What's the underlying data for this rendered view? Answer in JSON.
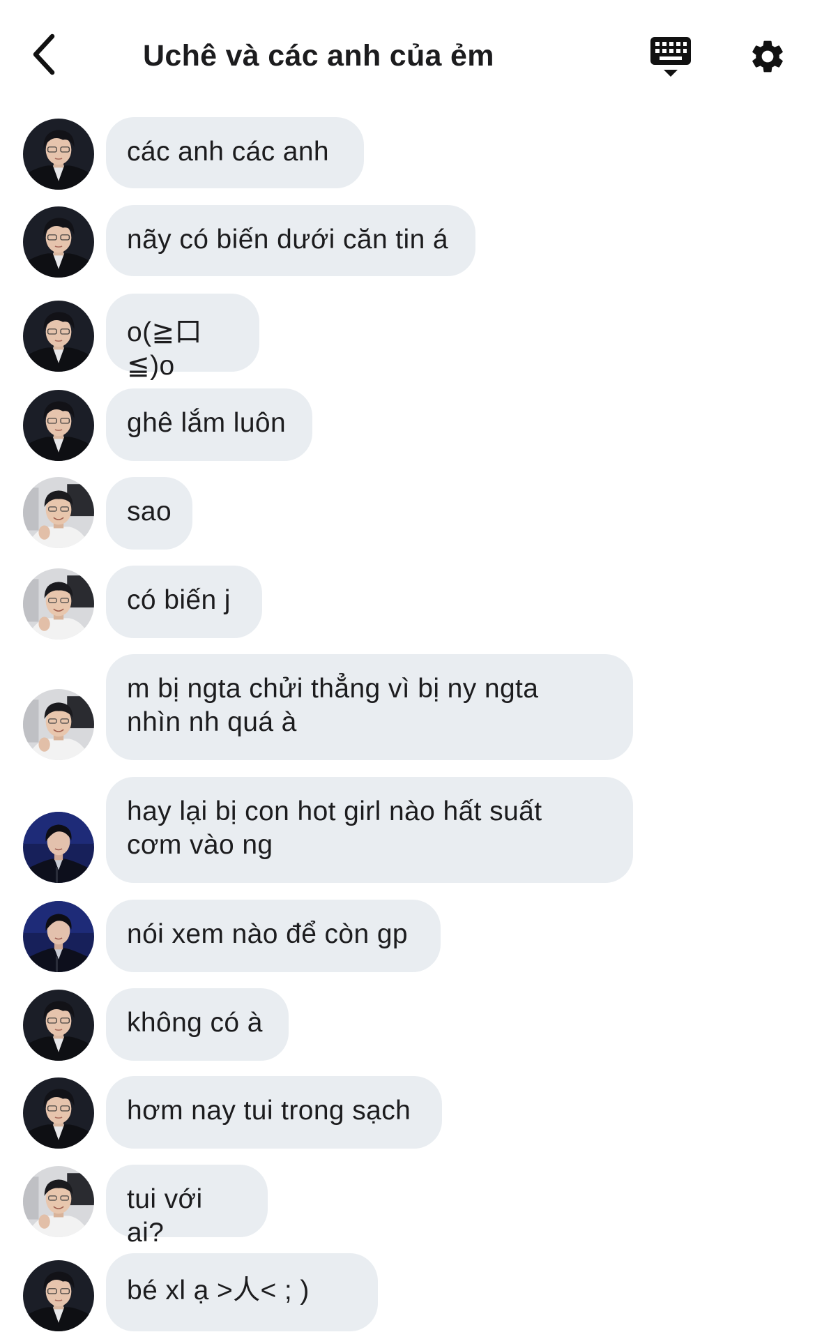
{
  "header": {
    "title": "Uchê và các anh của ẻm",
    "back_icon": "chevron-left-icon",
    "keyboard_icon": "keyboard-icon",
    "settings_icon": "gear-icon"
  },
  "messages": [
    {
      "avatar": "a",
      "text": "các anh các anh"
    },
    {
      "avatar": "a",
      "text": "nãy có biến dưới căn tin á"
    },
    {
      "avatar": "a",
      "text": "o(≧口≦)o"
    },
    {
      "avatar": "a",
      "text": "ghê lắm luôn"
    },
    {
      "avatar": "b",
      "text": "sao"
    },
    {
      "avatar": "b",
      "text": "có biến j"
    },
    {
      "avatar": "b",
      "text": "m bị ngta chửi thẳng vì bị ny ngta\nnhìn nh quá à"
    },
    {
      "avatar": "c",
      "text": "hay lại bị con hot girl nào hất suất\ncơm vào ng"
    },
    {
      "avatar": "c",
      "text": "nói xem nào để còn gp"
    },
    {
      "avatar": "a",
      "text": "không có à"
    },
    {
      "avatar": "a",
      "text": "hơm nay tui trong sạch"
    },
    {
      "avatar": "b",
      "text": "tui với ai?"
    },
    {
      "avatar": "a",
      "text": "bé xl ạ >人< ; )"
    }
  ],
  "colors": {
    "bubble": "#e9edf1",
    "text": "#1c1c1e",
    "background": "#ffffff"
  }
}
